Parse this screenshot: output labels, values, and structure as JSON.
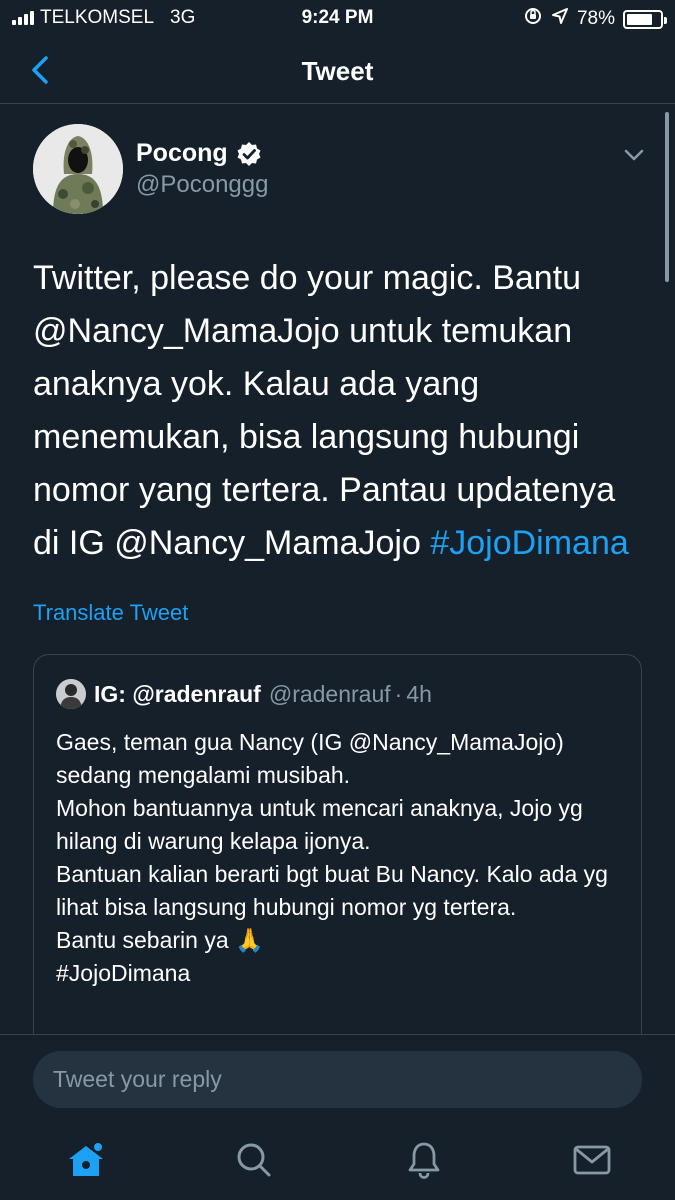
{
  "status_bar": {
    "carrier": "TELKOMSEL",
    "network": "3G",
    "time": "9:24 PM",
    "battery": "78%",
    "battery_level": 0.78
  },
  "nav": {
    "title": "Tweet",
    "back_icon": "chevron-left-icon"
  },
  "tweet": {
    "author_name": "Pocong",
    "author_handle": "@Poconggg",
    "verified": true,
    "text_main": "Twitter, please do your magic. Bantu @Nancy_MamaJojo untuk temukan anaknya yok. Kalau ada yang menemukan, bisa langsung hubungi nomor yang tertera. Pantau updatenya di IG @Nancy_MamaJojo ",
    "hashtag": "#JojoDimana",
    "translate_label": "Translate Tweet"
  },
  "quoted_tweet": {
    "name": "IG: @radenrauf",
    "handle": "@radenrauf",
    "separator": "·",
    "time": "4h",
    "body": "Gaes, teman gua Nancy (IG @Nancy_MamaJojo) sedang mengalami musibah.\nMohon bantuannya untuk mencari anaknya, Jojo yg hilang di warung kelapa ijonya.\nBantuan kalian berarti bgt buat Bu Nancy. Kalo ada yg lihat bisa langsung hubungi nomor yg tertera.\nBantu sebarin ya 🙏\n#JojoDimana"
  },
  "reply": {
    "placeholder": "Tweet your reply"
  },
  "tab_bar": {
    "items": [
      "home-icon",
      "search-icon",
      "bell-icon",
      "envelope-icon"
    ]
  },
  "colors": {
    "background": "#15202b",
    "accent": "#1da1f2",
    "secondary_text": "#8899a6",
    "divider": "#38444d",
    "input_bg": "#253341"
  }
}
